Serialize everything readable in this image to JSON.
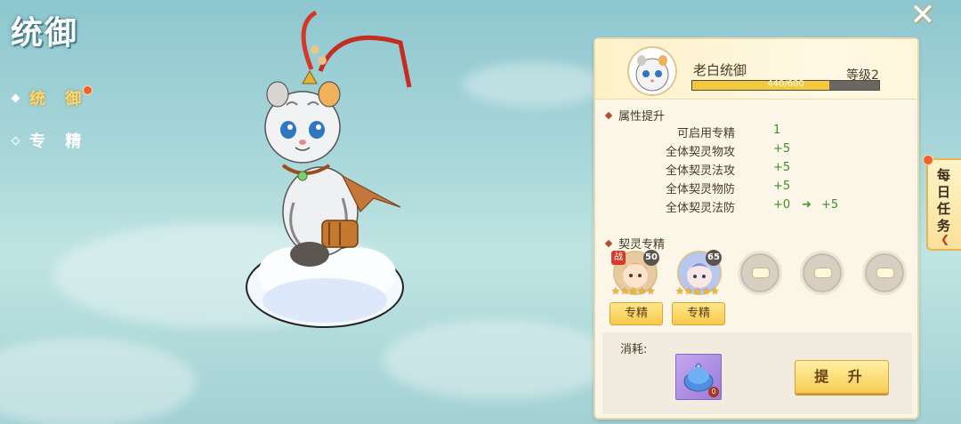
{
  "page": {
    "title": "统御",
    "close_icon": "close-x-icon"
  },
  "nav": {
    "items": [
      {
        "label": "统 御",
        "active": true,
        "has_badge": true
      },
      {
        "label": "专 精",
        "active": false,
        "has_badge": false
      }
    ]
  },
  "panel": {
    "name": "老白统御",
    "level": "等级2",
    "exp_text": "440/600",
    "exp_fraction": 0.733,
    "attributes_title": "属性提升",
    "attributes": [
      {
        "name": "可启用专精",
        "value": "1",
        "next": ""
      },
      {
        "name": "全体契灵物攻",
        "value": "+5",
        "next": ""
      },
      {
        "name": "全体契灵法攻",
        "value": "+5",
        "next": ""
      },
      {
        "name": "全体契灵物防",
        "value": "+5",
        "next": ""
      },
      {
        "name": "全体契灵法防",
        "value": "+0",
        "next": "+5"
      }
    ],
    "spec_title": "契灵专精",
    "heroes": [
      {
        "level": "50",
        "badge": "战",
        "stars": 5,
        "button": "专精",
        "color": "#e8c9a0"
      },
      {
        "level": "65",
        "badge": "",
        "stars": 5,
        "button": "专精",
        "color": "#b8c7f0"
      }
    ],
    "empty_slots": 3,
    "cost_label": "消耗:",
    "cost_item_count": "0",
    "upgrade_button": "提 升"
  },
  "daily_task": {
    "label": "每日任务"
  },
  "colors": {
    "accent_gold": "#f7cd50",
    "attr_green": "#3f8d2d",
    "badge_red": "#f2622b"
  }
}
